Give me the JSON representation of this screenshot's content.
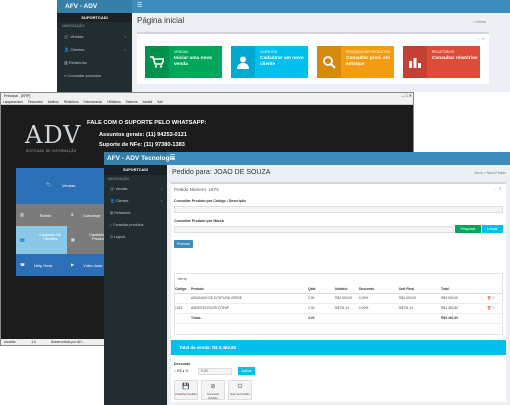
{
  "colors": {
    "primary": "#3c8dbc",
    "primary_dark": "#367fa9",
    "sidebar": "#222d32",
    "green": "#00a65a",
    "aqua": "#00c0ef",
    "orange": "#f39c12",
    "red": "#dd4b39",
    "desktop_bg": "#1c1c1c",
    "tile_blue": "#2b6fb6",
    "tile_gray": "#7b7b7b",
    "tile_light": "#8cc8e6"
  },
  "web_dashboard": {
    "brand": "AFV - ADV Tecnologia",
    "menu_icon": "hamburger-icon",
    "sidebar": {
      "header": "SUPORTCADI",
      "subheader": "NAVEGAÇÃO",
      "items": [
        {
          "label": "Vendas",
          "icon": "cart-icon",
          "has_chevron": true
        },
        {
          "label": "Clientes",
          "icon": "user-icon",
          "has_chevron": true
        },
        {
          "label": "Relatórios",
          "icon": "chart-icon",
          "has_chevron": false
        },
        {
          "label": "Consultar produtos",
          "icon": "search-icon",
          "has_chevron": false
        }
      ]
    },
    "title": "Página inicial",
    "breadcrumb": "Home",
    "tiles": [
      {
        "small": "VENDAS",
        "big": "Iniciar uma nova venda",
        "icon": "cart-icon",
        "color": "#00a65a"
      },
      {
        "small": "CLIENTES",
        "big": "Cadastrar um novo cliente",
        "icon": "user-icon",
        "color": "#00c0ef"
      },
      {
        "small": "PESQUISA DE PRODUTOS",
        "big": "Consultar prod. em estoque",
        "icon": "search-icon",
        "color": "#f39c12"
      },
      {
        "small": "RELATÓRIOS",
        "big": "Consultar relatórios",
        "icon": "chart-icon",
        "color": "#dd4b39"
      }
    ]
  },
  "desktop_app": {
    "title": "Principal - [ERP]",
    "window_buttons": "–  □  ✕",
    "menu": [
      "Lançamentos",
      "Financeiro",
      "Atalhos",
      "Relatórios",
      "Faturamento",
      "Utilitários",
      "Sistema",
      "Janela",
      "Sair"
    ],
    "logo": "ADV",
    "logo_sub": "SISTEMAS DE INFORMAÇÃO",
    "whatsapp_heading": "FALE COM O SUPORTE PELO WHATSAPP:",
    "support_general": "Assuntos gerais: (11) 94253-0121",
    "support_nfe": "Suporte de NFe: (11) 97380-1383",
    "tiles": [
      "Vendas",
      "Boleto",
      "Cobrança",
      "Cadastro de Clientes",
      "Cadastro de Produtos",
      "Help Desk",
      "Vídeo Aula"
    ],
    "status": [
      "Usuário:",
      "1.0",
      "Desenvolvido por AD..."
    ]
  },
  "order_page": {
    "brand": "AFV - ADV Tecnologia",
    "sidebar": {
      "header": "SUPORTCADI",
      "subheader": "NAVEGAÇÃO",
      "items": [
        {
          "label": "Vendas",
          "icon": "cart-icon",
          "has_chevron": true
        },
        {
          "label": "Clientes",
          "icon": "user-icon",
          "has_chevron": true
        },
        {
          "label": "Relatórios",
          "icon": "chart-icon",
          "has_chevron": false
        },
        {
          "label": "Consultar produtos",
          "icon": "search-icon",
          "has_chevron": false
        },
        {
          "label": "Logout",
          "icon": "power-icon",
          "has_chevron": false
        }
      ]
    },
    "title": "Pedido para: JOAO DE SOUZA",
    "breadcrumb": "Início  >  Novo Pedido",
    "order_number_label": "Pedido Número: 1674",
    "lookup_code_label": "Consultar Produto por Código / Descrição",
    "lookup_brand_label": "Consultar Produto por Marca",
    "btn_search": "Pesquisar",
    "btn_clear": "Limpar",
    "btn_search_product": "Procurar",
    "items_title": "Itens",
    "table": {
      "headers": [
        "Código",
        "Produto",
        "Qtde",
        "Unitário",
        "Desconto",
        "Unit Final",
        "Total",
        ""
      ],
      "rows": [
        [
          "",
          "ARAGANO DE COSTURA VERDE",
          "2,00",
          "R$2,000,00",
          "0,00%",
          "R$2.000,00",
          "R$4.000,00"
        ],
        [
          "1319",
          "AMORTECEDOR COFAP",
          "2,00",
          "R$731,41",
          "0,00%",
          "R$731,41",
          "R$1.462,80"
        ],
        [
          "",
          "Totais:",
          "4,00",
          "",
          "",
          "",
          "R$5.462,80"
        ]
      ]
    },
    "total_bar": "Total da venda: R$ 5.462,80",
    "discount_label": "Desconto",
    "discount_opts": [
      "R$",
      "%"
    ],
    "discount_value": "0,00",
    "btn_apply": "Aplicar",
    "actions": [
      {
        "label": "Finalizar Pedido",
        "icon": "save-icon"
      },
      {
        "label": "Cancelar Pedido",
        "icon": "ban-icon"
      },
      {
        "label": "Sair do Pedido",
        "icon": "power-icon"
      }
    ]
  }
}
